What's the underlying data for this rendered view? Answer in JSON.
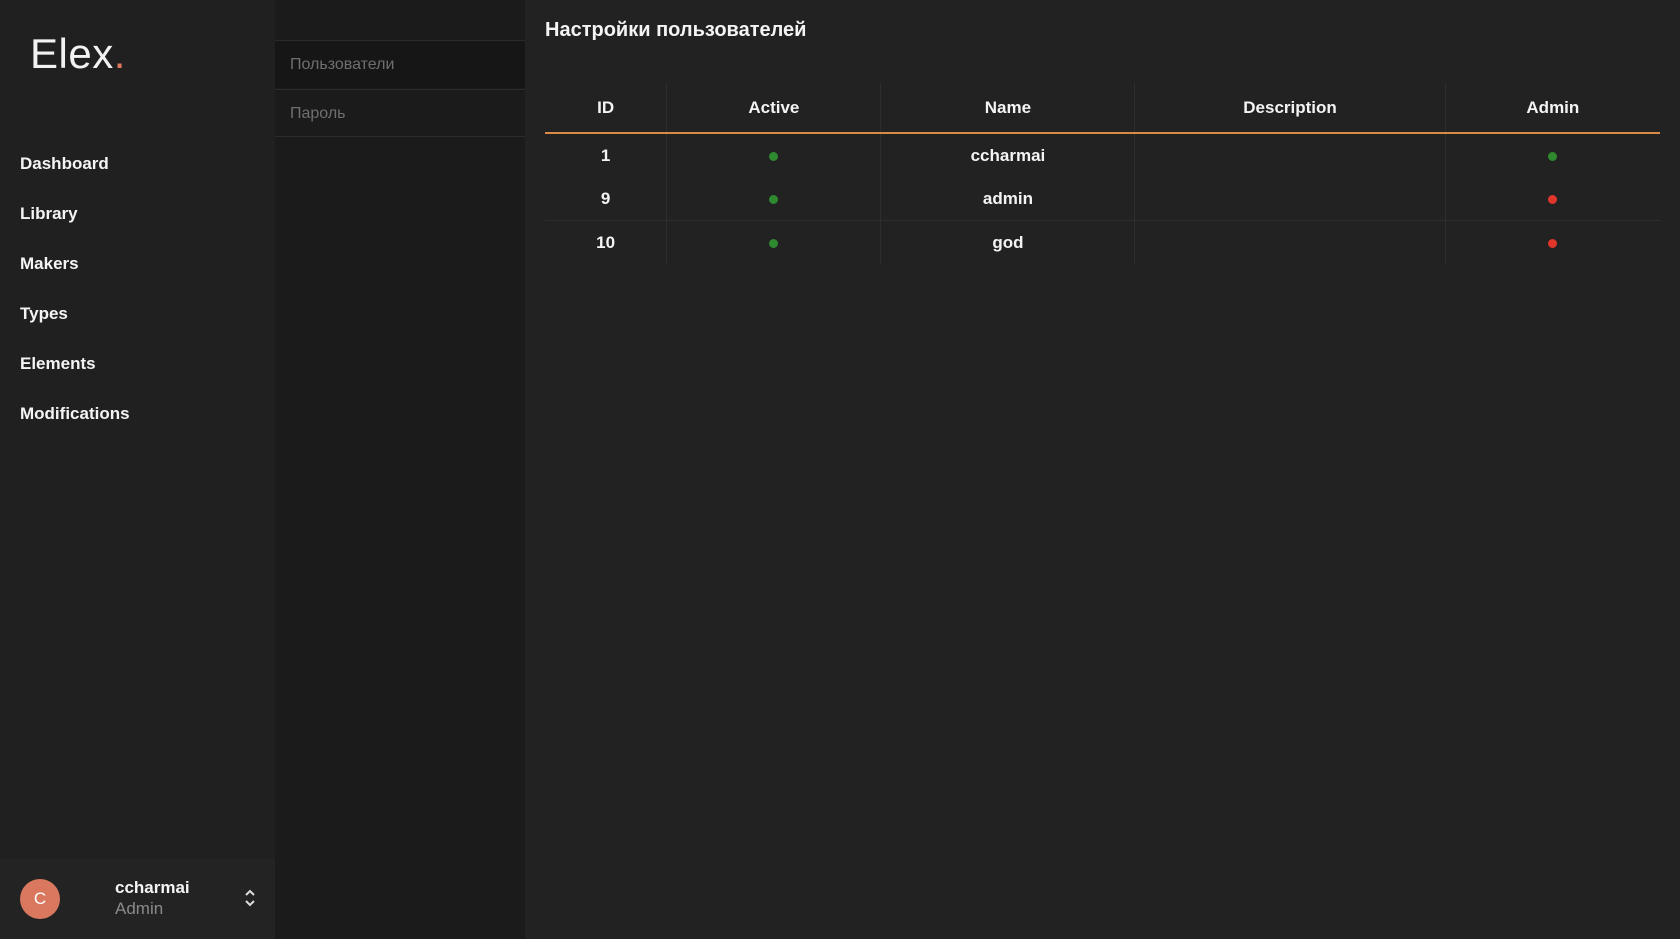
{
  "sidebar": {
    "logo_text": "Elex",
    "logo_dot": ".",
    "nav_items": [
      {
        "label": "Dashboard"
      },
      {
        "label": "Library"
      },
      {
        "label": "Makers"
      },
      {
        "label": "Types"
      },
      {
        "label": "Elements"
      },
      {
        "label": "Modifications"
      }
    ],
    "user": {
      "initial": "C",
      "name": "ccharmai",
      "role": "Admin"
    }
  },
  "subnav": {
    "items": [
      {
        "label": "Пользователи",
        "active": true
      },
      {
        "label": "Пароль",
        "active": false
      }
    ]
  },
  "main": {
    "title": "Настройки пользователей",
    "table": {
      "headers": [
        "ID",
        "Active",
        "Name",
        "Description",
        "Admin"
      ],
      "rows": [
        {
          "id": "1",
          "active": true,
          "name": "ccharmai",
          "description": "",
          "admin": true
        },
        {
          "id": "9",
          "active": true,
          "name": "admin",
          "description": "",
          "admin": false
        },
        {
          "id": "10",
          "active": true,
          "name": "god",
          "description": "",
          "admin": false
        }
      ]
    }
  },
  "colors": {
    "accent": "#d98a45",
    "status_true": "#2f8a2f",
    "status_false": "#e0362c",
    "avatar": "#d9785e"
  }
}
